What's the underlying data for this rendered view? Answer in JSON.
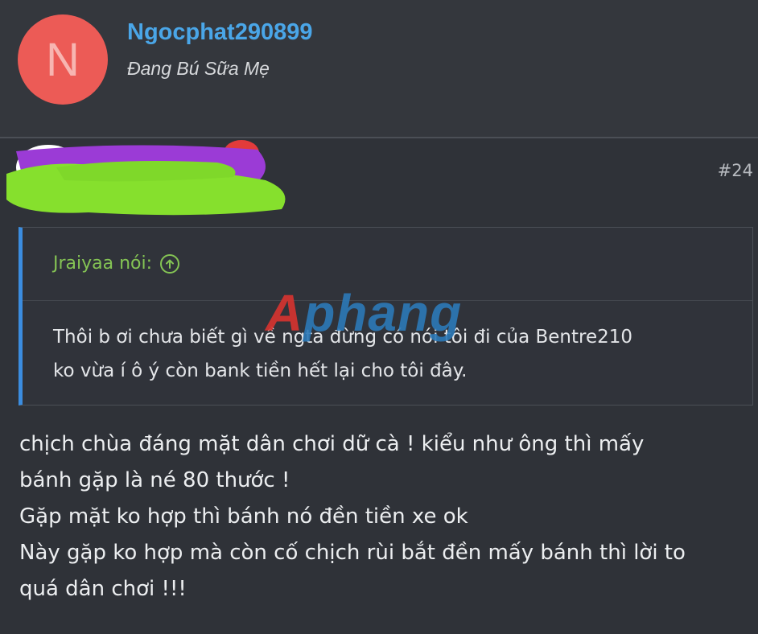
{
  "user": {
    "avatar_letter": "N",
    "avatar_color": "#ec5b56",
    "username": "Ngocphat290899",
    "user_title": "Đang Bú Sữa Mẹ"
  },
  "post": {
    "number": "#24",
    "quote": {
      "author": "Jraiyaa nói:",
      "icon": "arrow-up-circle-icon",
      "lines": [
        "Thôi b ơi chưa biết gì về ngta đừng có nói tôi đi của Bentre210",
        "ko vừa í ô ý còn bank tiền hết lại cho tôi đây."
      ]
    },
    "body_lines": [
      "chịch chùa đáng mặt dân chơi dữ cà ! kiểu như ông thì mấy",
      "bánh gặp là né 80 thước !",
      "Gặp mặt ko hợp thì bánh nó đền tiền xe ok",
      "Này gặp ko hợp mà còn cố chịch rùi bắt đền mấy bánh thì lời to",
      "quá dân chơi !!!"
    ]
  },
  "watermark": {
    "first": "A",
    "rest": "phang"
  },
  "colors": {
    "background": "#2f3238",
    "username": "#4aa6e8",
    "quote_author": "#84c354",
    "quote_border": "#3b8de0"
  }
}
